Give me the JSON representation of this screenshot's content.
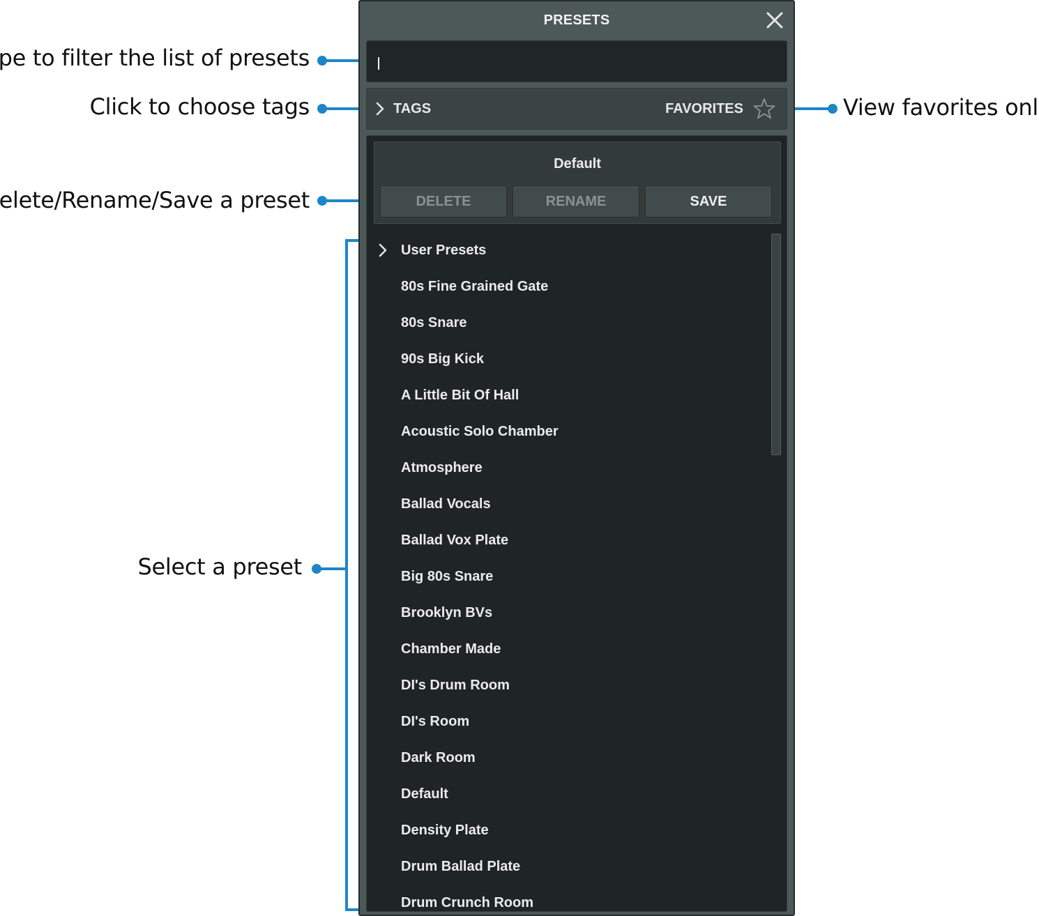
{
  "callouts": {
    "filter": "Type to filter the list of presets",
    "tags": "Click to choose tags",
    "buttons": "Delete/Rename/Save a preset",
    "select": "Select a preset",
    "favorites": "View favorites only"
  },
  "panel": {
    "title": "PRESETS",
    "close_icon": "close-icon",
    "search": {
      "value": "",
      "placeholder": ""
    },
    "tags_label": "TAGS",
    "favorites_label": "FAVORITES",
    "current_preset": "Default",
    "buttons": {
      "delete": "DELETE",
      "rename": "RENAME",
      "save": "SAVE"
    },
    "list": [
      "User Presets",
      "80s Fine Grained Gate",
      "80s Snare",
      "90s Big Kick",
      "A Little Bit Of Hall",
      "Acoustic Solo Chamber",
      "Atmosphere",
      "Ballad Vocals",
      "Ballad Vox Plate",
      "Big 80s Snare",
      "Brooklyn BVs",
      "Chamber Made",
      "DI's Drum Room",
      "DI's Room",
      "Dark Room",
      "Default",
      "Density Plate",
      "Drum Ballad Plate",
      "Drum Crunch Room"
    ]
  },
  "colors": {
    "accent": "#1d86c8",
    "panel": "#4d5858",
    "list_bg": "#1f2424"
  }
}
